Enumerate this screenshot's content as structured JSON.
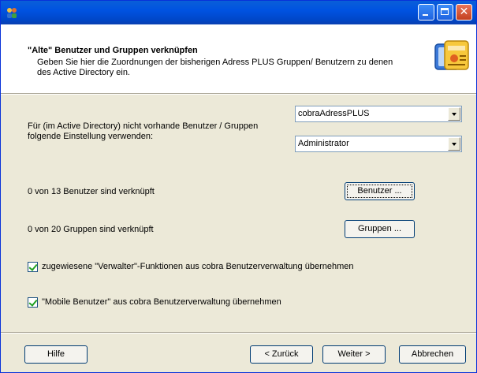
{
  "window": {
    "title": ""
  },
  "header": {
    "title": "\"Alte\" Benutzer und Gruppen verknüpfen",
    "description": "Geben Sie hier die Zuordnungen der bisherigen Adress PLUS Gruppen/ Benutzern zu denen des Active Directory ein."
  },
  "settings": {
    "label": "Für (im Active Directory) nicht vorhande Benutzer / Gruppen folgende Einstellung verwenden:",
    "combo1_value": "cobraAdressPLUS",
    "combo2_value": "Administrator"
  },
  "users": {
    "status": "0 von 13 Benutzer sind verknüpft",
    "button_label": "Benutzer ..."
  },
  "groups": {
    "status": "0 von 20 Gruppen sind verknüpft",
    "button_label": "Gruppen ..."
  },
  "options": {
    "verwalter_label": "zugewiesene \"Verwalter\"-Funktionen aus cobra Benutzerverwaltung übernehmen",
    "verwalter_checked": true,
    "mobile_label": "\"Mobile Benutzer\" aus cobra Benutzerverwaltung übernehmen",
    "mobile_checked": true
  },
  "footer": {
    "help_label": "Hilfe",
    "back_label": "< Zurück",
    "next_label": "Weiter >",
    "cancel_label": "Abbrechen"
  },
  "icons": {
    "app": "users-icon",
    "header": "address-card-icon",
    "minimize": "minimize-icon",
    "maximize": "maximize-icon",
    "close": "close-icon"
  },
  "colors": {
    "titlebar": "#0053e1",
    "face": "#ece9d8",
    "header_bg": "#ffffff",
    "check": "#21a121"
  }
}
